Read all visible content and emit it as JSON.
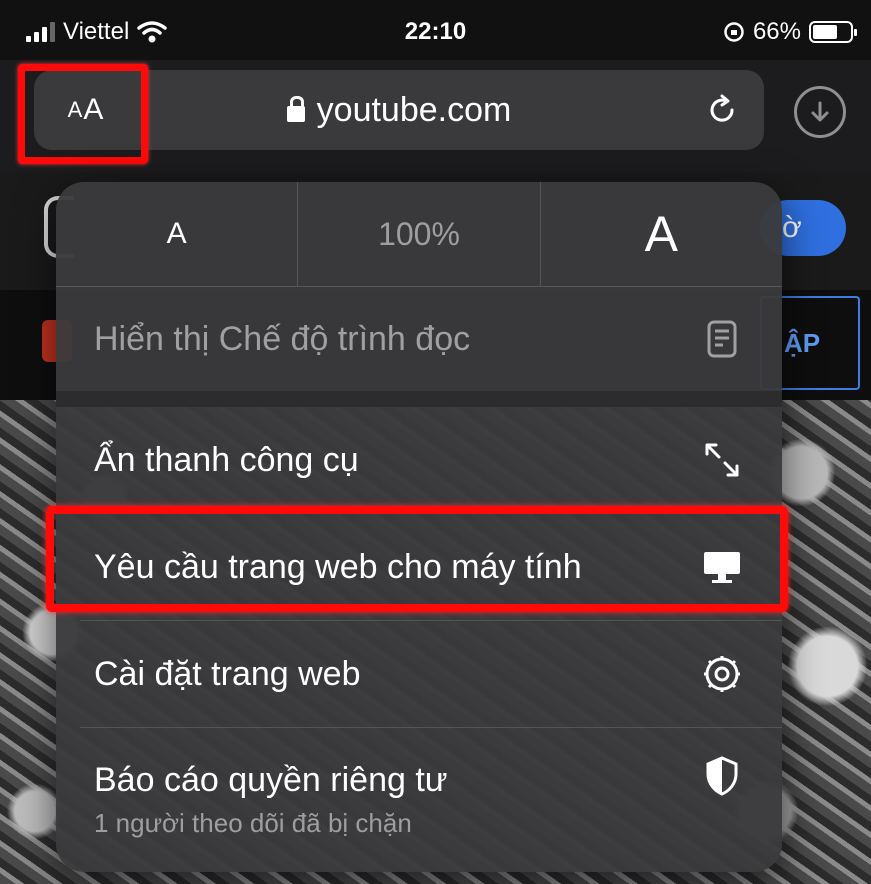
{
  "status_bar": {
    "carrier": "Viettel",
    "time": "22:10",
    "battery_percent": "66%",
    "battery_level": 0.66
  },
  "address_bar": {
    "aa_small": "A",
    "aa_large": "A",
    "url": "youtube.com"
  },
  "background_page": {
    "button_partial": "ờ",
    "login_partial": "ẬP"
  },
  "menu": {
    "zoom": {
      "decrease_label": "A",
      "level": "100%",
      "increase_label": "A"
    },
    "items": [
      {
        "label": "Hiển thị Chế độ trình đọc",
        "icon": "reader-icon",
        "enabled": false
      },
      {
        "label": "Ẩn thanh công cụ",
        "icon": "resize-arrows-icon",
        "enabled": true
      },
      {
        "label": "Yêu cầu trang web cho máy tính",
        "icon": "desktop-icon",
        "enabled": true
      },
      {
        "label": "Cài đặt trang web",
        "icon": "gear-icon",
        "enabled": true
      },
      {
        "label": "Báo cáo quyền riêng tư",
        "sublabel": "1 người theo dõi đã bị chặn",
        "icon": "shield-icon",
        "enabled": true
      }
    ]
  },
  "colors": {
    "highlight": "#ff0a0a",
    "accent_blue": "#2f6fdf"
  }
}
